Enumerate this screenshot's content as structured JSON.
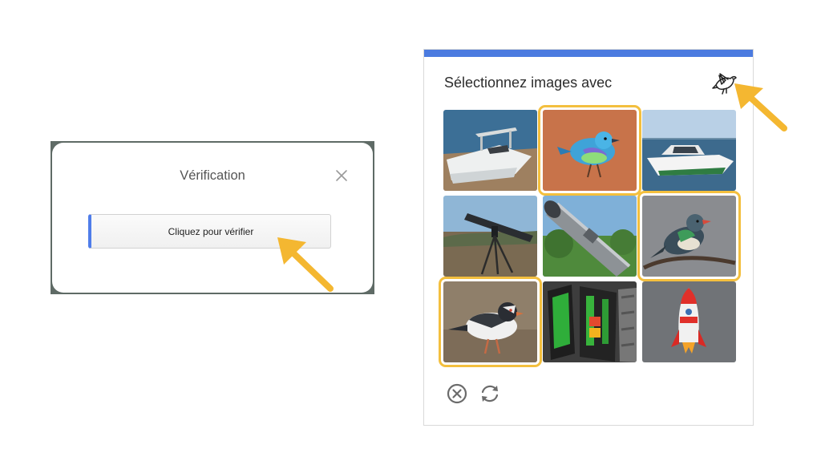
{
  "verification": {
    "title": "Vérification",
    "button_label": "Cliquez pour vérifier"
  },
  "captcha": {
    "instruction": "Sélectionnez images avec",
    "target_icon": "bird-icon",
    "accent_color": "#4b7be0",
    "selection_color": "#f3bf3e",
    "tiles": [
      {
        "subject": "boat",
        "selected": false
      },
      {
        "subject": "bird",
        "selected": true
      },
      {
        "subject": "boat",
        "selected": false
      },
      {
        "subject": "telescope",
        "selected": false
      },
      {
        "subject": "telescope",
        "selected": false
      },
      {
        "subject": "bird",
        "selected": true
      },
      {
        "subject": "bird",
        "selected": true
      },
      {
        "subject": "traffic-light",
        "selected": false
      },
      {
        "subject": "rocket",
        "selected": false
      }
    ],
    "footer_icons": [
      "close-circle-icon",
      "refresh-icon"
    ]
  },
  "annotation_color": "#f4b731"
}
